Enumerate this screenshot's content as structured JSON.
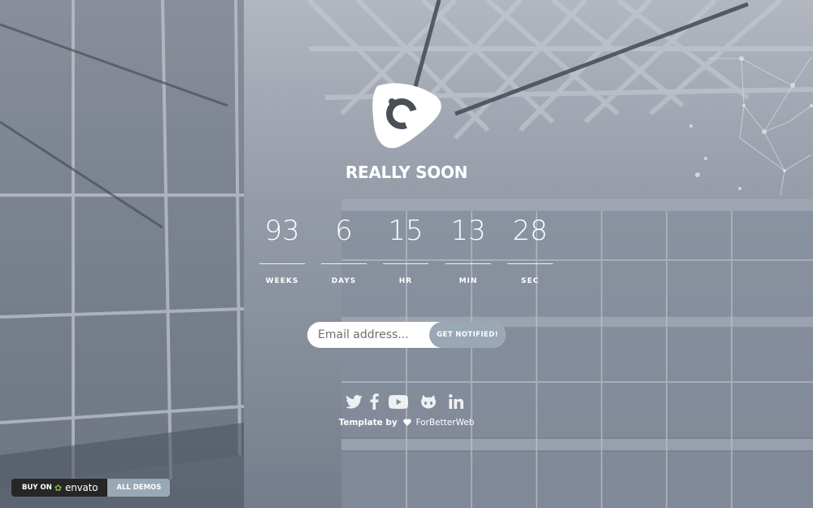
{
  "headline": "REALLY SOON",
  "countdown": [
    {
      "value": "93",
      "label": "WEEKS"
    },
    {
      "value": "6",
      "label": "DAYS"
    },
    {
      "value": "15",
      "label": "HR"
    },
    {
      "value": "13",
      "label": "MIN"
    },
    {
      "value": "28",
      "label": "SEC"
    }
  ],
  "signup": {
    "placeholder": "Email address...",
    "button_label": "GET NOTIFIED!"
  },
  "social_icons": [
    "twitter-icon",
    "facebook-icon",
    "youtube-icon",
    "github-icon",
    "linkedin-icon"
  ],
  "credit": {
    "prefix": "Template by",
    "author": "ForBetterWeb"
  },
  "envato": {
    "buy_prefix": "BUY ON",
    "brand": "envato",
    "demos_label": "ALL DEMOS"
  },
  "colors": {
    "accent": "#9aa8b6",
    "text": "#ffffff",
    "envato_dark": "#262626",
    "envato_green": "#82b541"
  }
}
